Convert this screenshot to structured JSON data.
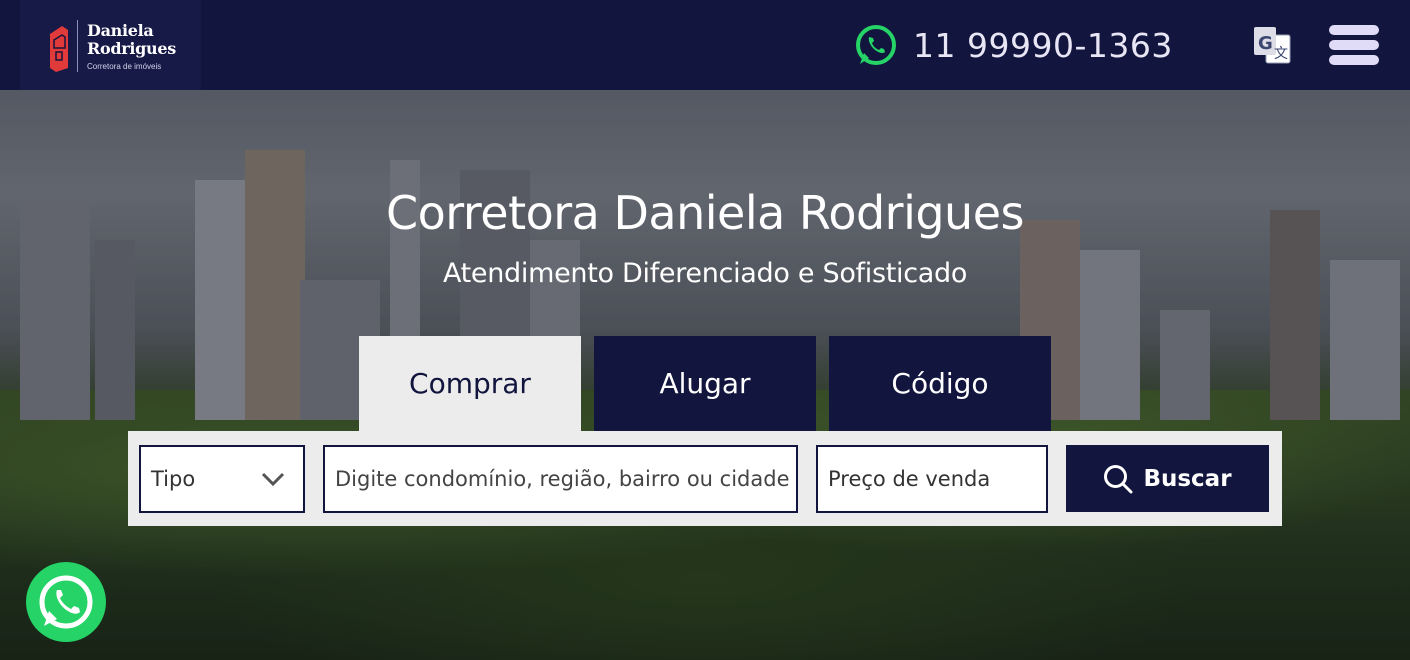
{
  "header": {
    "logo": {
      "name_line1": "Daniela",
      "name_line2": "Rodrigues",
      "tagline": "Corretora de imóveis"
    },
    "phone": "11 99990-1363",
    "icons": {
      "whatsapp": "whatsapp-icon",
      "translate": "translate-icon",
      "menu": "hamburger-menu-icon"
    }
  },
  "hero": {
    "title": "Corretora Daniela Rodrigues",
    "subtitle": "Atendimento Diferenciado e Sofisticado"
  },
  "tabs": [
    {
      "label": "Comprar",
      "active": true
    },
    {
      "label": "Alugar",
      "active": false
    },
    {
      "label": "Código",
      "active": false
    }
  ],
  "search": {
    "type_select": "Tipo",
    "location_placeholder": "Digite condomínio, região, bairro ou cidade",
    "price_select": "Preço de venda",
    "button_label": "Buscar"
  },
  "colors": {
    "navy": "#12153d",
    "whatsapp_green": "#25d366",
    "light_panel": "#ececec",
    "logo_red": "#e03a3a"
  }
}
